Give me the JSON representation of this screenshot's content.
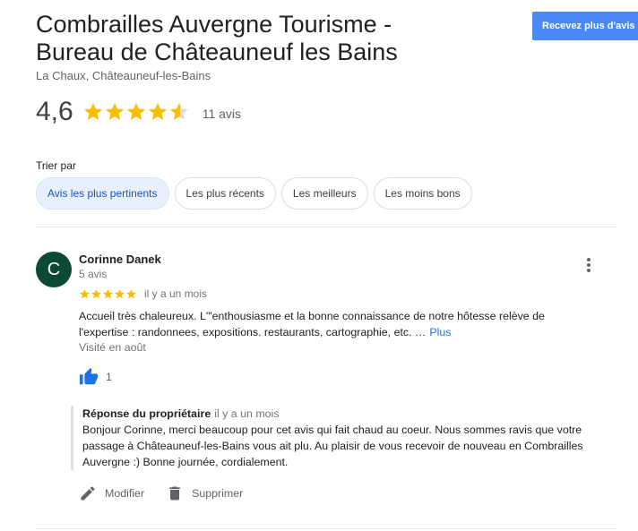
{
  "place": {
    "title": "Combrailles Auvergne Tourisme - Bureau de Châteauneuf les Bains",
    "address": "La Chaux, Châteauneuf-les-Bains",
    "cta_label": "Recevez plus d'avis",
    "rating": "4,6",
    "rating_fraction": 0.92,
    "review_count": "11 avis",
    "star_color": "#fbbc04"
  },
  "sort": {
    "label": "Trier par",
    "options": [
      {
        "label": "Avis les plus pertinents",
        "selected": true
      },
      {
        "label": "Les plus récents",
        "selected": false
      },
      {
        "label": "Les meilleurs",
        "selected": false
      },
      {
        "label": "Les moins bons",
        "selected": false
      }
    ]
  },
  "review": {
    "avatar_letter": "C",
    "avatar_color": "#0b4a35",
    "author": "Corinne Danek",
    "author_reviews": "5 avis",
    "stars": 5,
    "time": "il y a un mois",
    "text": "Accueil très chaleureux. L'\"enthousiasme et la bonne connaissance de notre hôtesse relève de l'expertise : randonnees, expositions. restaurants, cartographie, etc. …",
    "more_label": "Plus",
    "visited": "Visité en août",
    "likes": "1",
    "owner_response": {
      "label": "Réponse du propriétaire",
      "time": "il y a un mois",
      "text": "Bonjour Corinne, merci beaucoup pour cet avis qui fait chaud au coeur. Nous sommes ravis que votre passage à Châteauneuf-les-Bains vous ait plu. Au plaisir de vous recevoir de nouveau en Combrailles Auvergne :) Bonne journée, cordialement."
    },
    "actions": {
      "edit_label": "Modifier",
      "delete_label": "Supprimer"
    }
  }
}
